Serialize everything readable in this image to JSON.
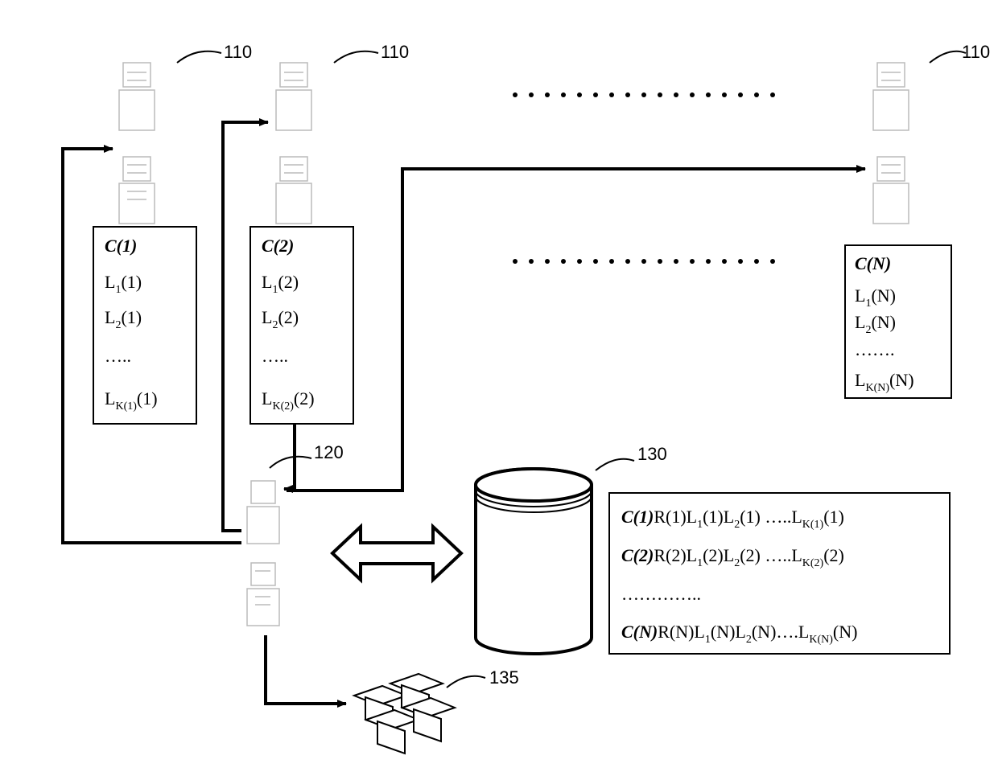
{
  "refs": {
    "node_110_a": "110",
    "node_110_b": "110",
    "node_110_c": "110",
    "server_120": "120",
    "db_130": "130",
    "clients_135": "135"
  },
  "box1": {
    "title": "C(1)",
    "l1": "L",
    "l1_sub": "1",
    "l1_arg": "(1)",
    "l2": "L",
    "l2_sub": "2",
    "l2_arg": "(1)",
    "dots": "…..",
    "lk": "L",
    "lk_sub": "K(1)",
    "lk_arg": "(1)"
  },
  "box2": {
    "title": "C(2)",
    "l1": "L",
    "l1_sub": "1",
    "l1_arg": "(2)",
    "l2": "L",
    "l2_sub": "2",
    "l2_arg": "(2)",
    "dots": "…..",
    "lk": "L",
    "lk_sub": "K(2)",
    "lk_arg": "(2)"
  },
  "boxN": {
    "title": "C(N)",
    "l1": "L",
    "l1_sub": "1",
    "l1_arg": "(N)",
    "l2": "L",
    "l2_sub": "2",
    "l2_arg": "(N)",
    "dots": "…….",
    "lk": "L",
    "lk_sub": "K(N)",
    "lk_arg": "(N)"
  },
  "db_box": {
    "r1_a": "C(1)",
    "r1_b": "R(1)L",
    "r1_s1": "1",
    "r1_c": "(1)L",
    "r1_s2": "2",
    "r1_d": "(1) …..L",
    "r1_s3": "K(1)",
    "r1_e": "(1)",
    "r2_a": "C(2)",
    "r2_b": "R(2)L",
    "r2_s1": "1",
    "r2_c": "(2)L",
    "r2_s2": "2",
    "r2_d": "(2) …..L",
    "r2_s3": "K(2)",
    "r2_e": "(2)",
    "r3": "…………..",
    "r4_a": "C(N)",
    "r4_b": "R(N)L",
    "r4_s1": "1",
    "r4_c": "(N)L",
    "r4_s2": "2",
    "r4_d": "(N)….L",
    "r4_s3": "K(N)",
    "r4_e": "(N)"
  }
}
